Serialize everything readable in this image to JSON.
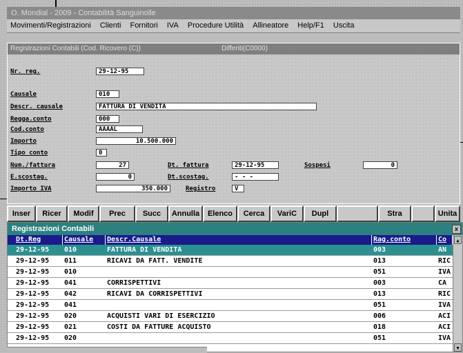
{
  "app_title": "O. Mondial - 2009 - Contabilità Sanguinolle",
  "menu": [
    "Movimenti/Registrazioni",
    "Clienti",
    "Fornitori",
    "IVA",
    "Procedure Utilità",
    "Allineatore",
    "Help/F1",
    "Uscita"
  ],
  "form": {
    "title": "Registrazioni Contabili (Cod. Ricovero (C))",
    "subtitle": "Differiti(C0000)",
    "fields": {
      "nr_reg": {
        "label": "Nr. reg.",
        "value": "29-12-95"
      },
      "causale": {
        "label": "Causale",
        "value": "010"
      },
      "descr_causale": {
        "label": "Descr. causale",
        "value": "FATTURA DI VENDITA"
      },
      "regga_conto": {
        "label": "Regga.conto",
        "value": "000"
      },
      "cod_conto": {
        "label": "Cod.conto",
        "value": "AAAAL"
      },
      "importo": {
        "label": "Importo",
        "value": "10.500.000"
      },
      "tipo_conto": {
        "label": "Tipo conto",
        "value": "0"
      },
      "num_fattura": {
        "label": "Num./fattura",
        "value": "27"
      },
      "dt_fattura": {
        "label": "Dt. fattura",
        "value": "29-12-95"
      },
      "sospesi": {
        "label": "Sospesi",
        "value": "0"
      },
      "e_scostag": {
        "label": "E.scostag.",
        "value": "0"
      },
      "dt_scostag": {
        "label": "Dt.scostag.",
        "value": "- - -"
      },
      "importo_iva": {
        "label": "Importo IVA",
        "value": "350.000"
      },
      "registro": {
        "label": "Registro",
        "value": "V"
      }
    }
  },
  "toolbar": [
    "Inser",
    "Ricer",
    "Modif",
    "Prec",
    "Succ",
    "Annulla",
    "Elenco",
    "Cerca",
    "VariC",
    "Dupl",
    "",
    "Stra",
    "",
    "Unita"
  ],
  "grid": {
    "title": "Registrazioni Contabili",
    "close_label": "x",
    "columns": [
      "Dt.Reg",
      "Causale",
      "Descr.Causale",
      "Rag.conto",
      "Co"
    ],
    "rows": [
      [
        "29-12-95",
        "010",
        "FATTURA DI VENDITA",
        "003",
        "AN"
      ],
      [
        "29-12-95",
        "011",
        "RICAVI DA FATT. VENDITE",
        "013",
        "RIC"
      ],
      [
        "29-12-95",
        "010",
        "",
        "051",
        "IVA"
      ],
      [
        "29-12-95",
        "041",
        "CORRISPETTIVI",
        "003",
        "CA"
      ],
      [
        "29-12-95",
        "042",
        "RICAVI DA CORRISPETTIVI",
        "013",
        "RIC"
      ],
      [
        "29-12-95",
        "041",
        "",
        "051",
        "IVA"
      ],
      [
        "29-12-95",
        "020",
        "ACQUISTI VARI DI ESERCIZIO",
        "006",
        "ACI"
      ],
      [
        "29-12-95",
        "021",
        "COSTI DA FATTURE ACQUISTO",
        "018",
        "ACI"
      ],
      [
        "29-12-95",
        "020",
        "",
        "051",
        "IVA"
      ]
    ],
    "selected_row": 0,
    "scroll_up": "▲",
    "scroll_down": "▼"
  },
  "colors": {
    "selected_row": "#2b9090",
    "header_bg": "#1a1a8a",
    "grid_title_bg": "#2c8080"
  }
}
